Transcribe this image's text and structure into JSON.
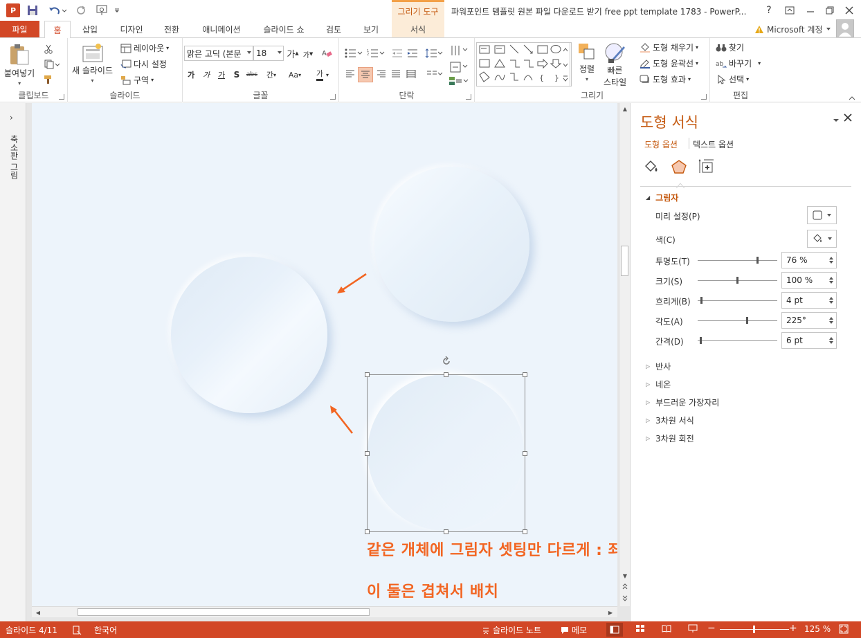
{
  "titlebar": {
    "app_badge": "P",
    "context_tab_group": "그리기 도구",
    "window_title": "파워포인트 템플릿 원본 파일 다운로드 받기 free ppt template 1783 - PowerP...",
    "help": "?"
  },
  "tabs": {
    "file": "파일",
    "home": "홈",
    "insert": "삽입",
    "design": "디자인",
    "transitions": "전환",
    "animations": "애니메이션",
    "slideshow": "슬라이드 쇼",
    "review": "검토",
    "view": "보기",
    "format": "서식"
  },
  "account": {
    "label": "Microsoft 계정"
  },
  "ribbon": {
    "clipboard": {
      "paste": "붙여넣기",
      "label": "클립보드"
    },
    "slides": {
      "new_slide": "새 슬라이드",
      "layout": "레이아웃",
      "reset": "다시 설정",
      "section": "구역",
      "label": "슬라이드"
    },
    "font": {
      "font_name": "맑은 고딕 (본문",
      "font_size": "18",
      "grow": "가",
      "shrink": "가",
      "bold": "가",
      "italic": "가",
      "underline": "가",
      "shadow": "S",
      "strike": "abc",
      "spacing": "간",
      "case": "Aa",
      "color": "가",
      "label": "글꼴"
    },
    "paragraph": {
      "label": "단락"
    },
    "drawing": {
      "arrange": "정렬",
      "quick_styles": "빠른",
      "quick_styles2": "스타일",
      "fill": "도형 채우기",
      "outline": "도형 윤곽선",
      "effects": "도형 효과",
      "label": "그리기"
    },
    "editing": {
      "find": "찾기",
      "replace": "바꾸기",
      "select": "선택",
      "label": "편집"
    }
  },
  "leftpane": {
    "label": "축소판 그림"
  },
  "slide": {
    "annotation_line1": "같은 개체에 그림자 셋팅만 다르게 : 좌측 상단 화이트",
    "annotation_line2": "이 둘은 겹쳐서 배치"
  },
  "format_pane": {
    "title": "도형 서식",
    "tab_shape": "도형 옵션",
    "tab_text": "텍스트 옵션",
    "section_shadow": "그림자",
    "preset_label": "미리 설정(P)",
    "color_label": "색(C)",
    "transparency_label": "투명도(T)",
    "transparency_value": "76 %",
    "transparency_level": 0.76,
    "size_label": "크기(S)",
    "size_value": "100 %",
    "size_level": 0.5,
    "blur_label": "흐리게(B)",
    "blur_value": "4 pt",
    "blur_level": 0.04,
    "angle_label": "각도(A)",
    "angle_value": "225°",
    "angle_level": 0.625,
    "distance_label": "간격(D)",
    "distance_value": "6 pt",
    "distance_level": 0.03,
    "section_reflection": "반사",
    "section_glow": "네온",
    "section_soft_edges": "부드러운 가장자리",
    "section_3d_format": "3차원 서식",
    "section_3d_rotation": "3차원 회전"
  },
  "statusbar": {
    "slide_count": "슬라이드 4/11",
    "language": "한국어",
    "notes": "슬라이드 노트",
    "comments": "메모",
    "zoom": "125 %",
    "zoom_minus": "−",
    "zoom_plus": "+"
  },
  "colors": {
    "accent": "#d24726",
    "annotation": "#f26522",
    "slide_bg": "#edf4fb",
    "pane_title": "#c55a11"
  }
}
